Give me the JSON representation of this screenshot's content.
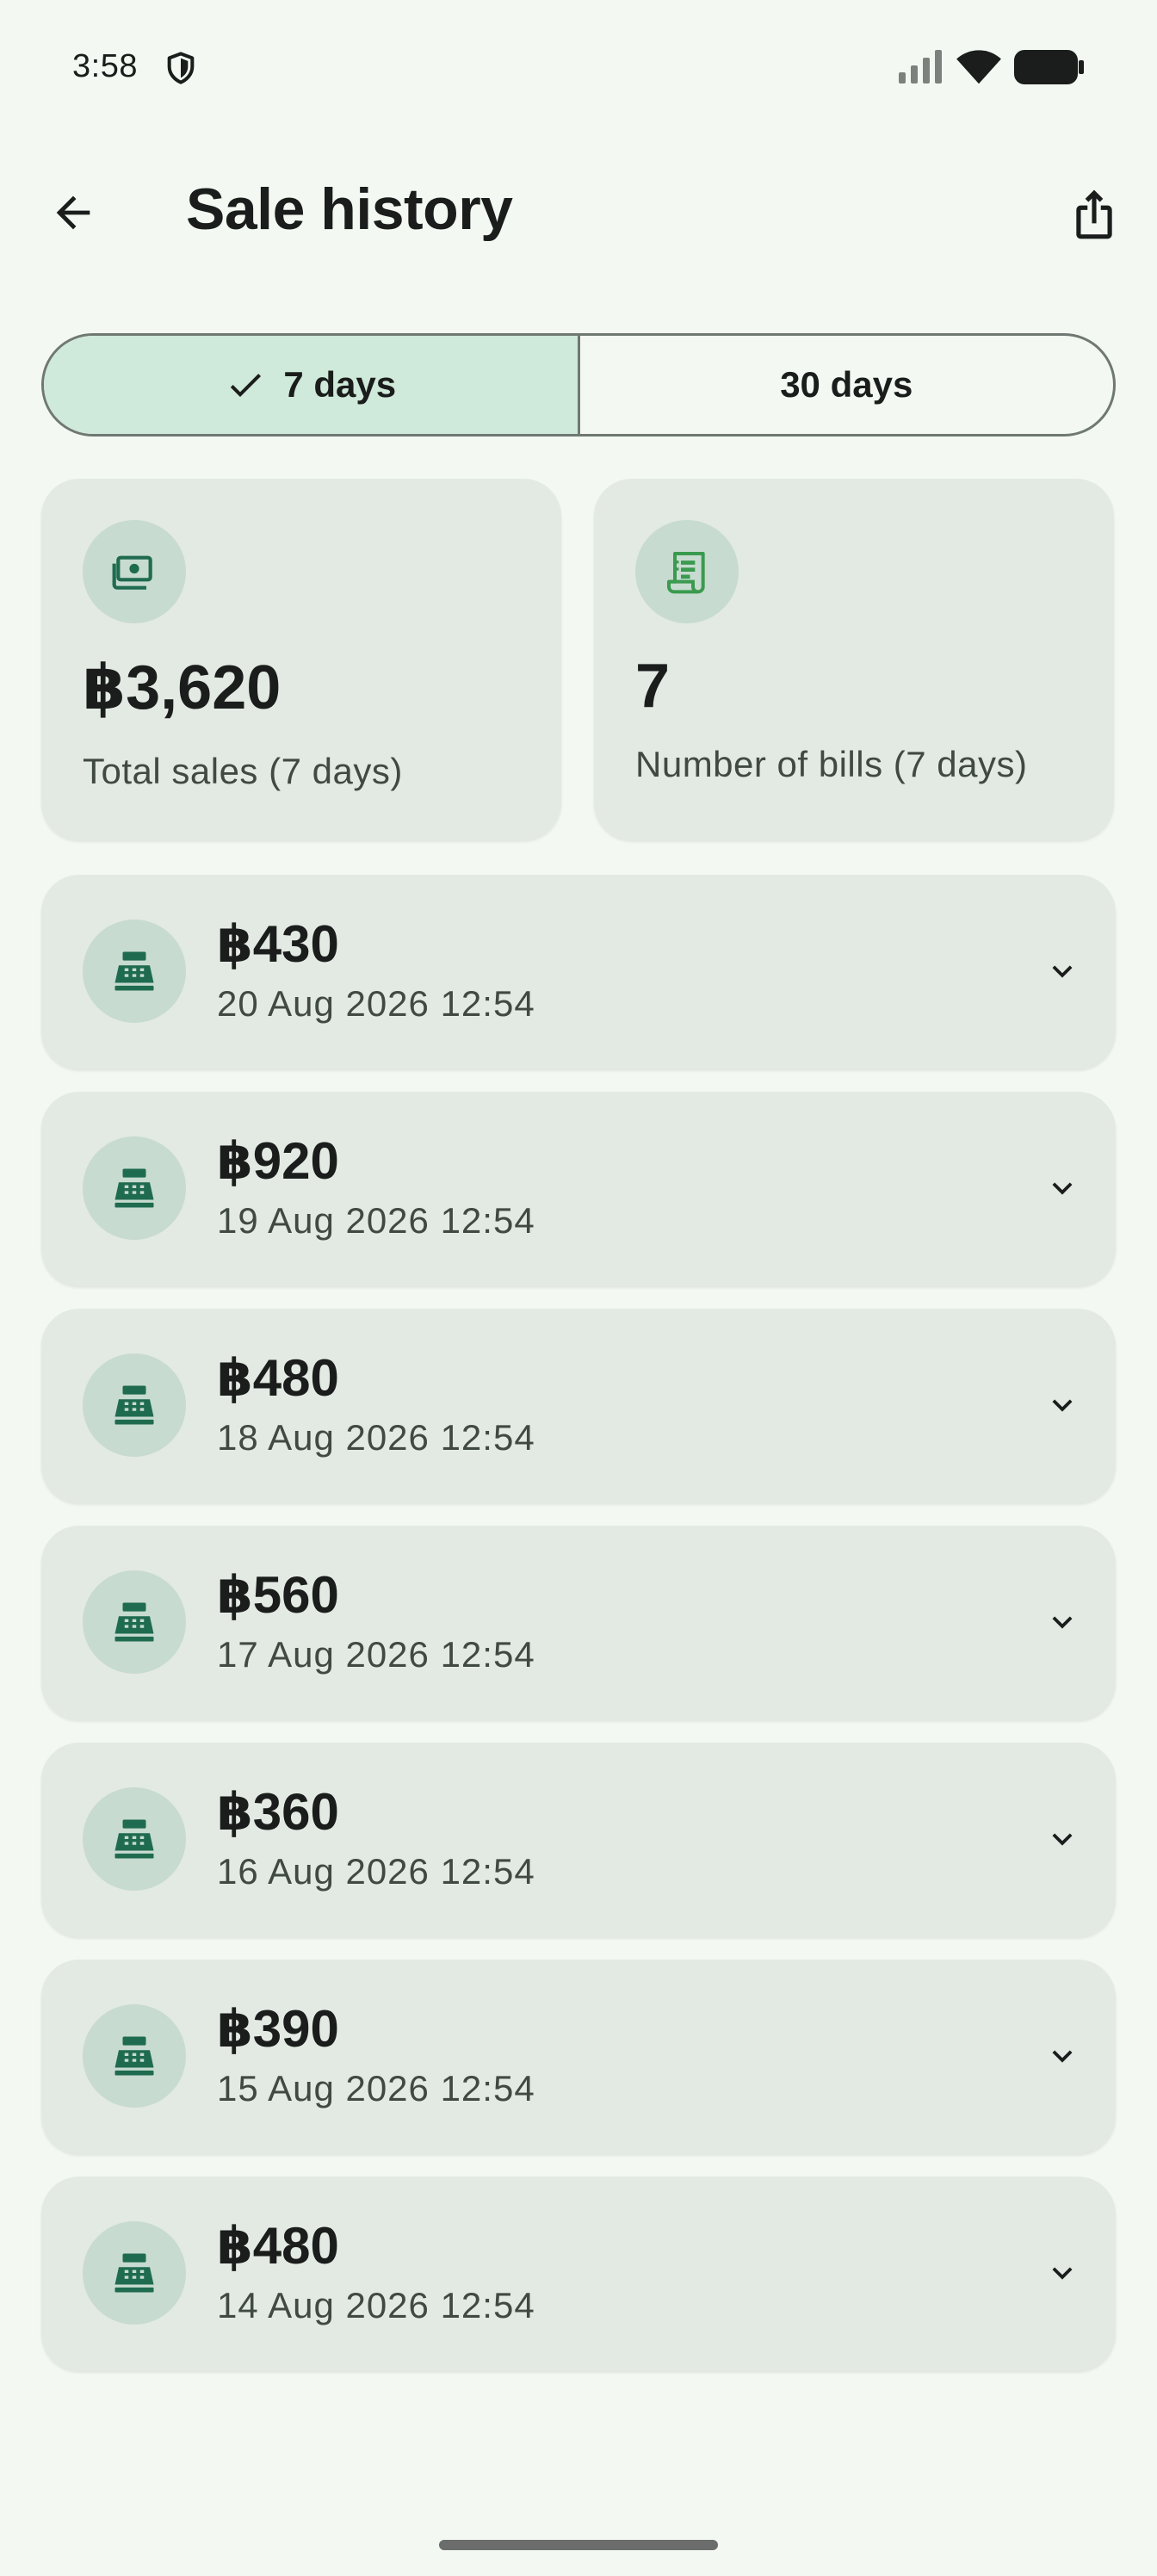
{
  "status_bar": {
    "time": "3:58",
    "icons": [
      "shield-icon",
      "signal-icon",
      "wifi-icon",
      "battery-icon"
    ]
  },
  "app_bar": {
    "title": "Sale history",
    "back_icon": "arrow-back-icon",
    "share_icon": "share-icon"
  },
  "range_selector": {
    "options": [
      {
        "label": "7 days",
        "selected": true
      },
      {
        "label": "30 days",
        "selected": false
      }
    ]
  },
  "summary": {
    "total_sales": {
      "value": "฿3,620",
      "label": "Total sales (7 days)",
      "icon": "money-icon"
    },
    "bill_count": {
      "value": "7",
      "label": "Number of bills (7 days)",
      "icon": "receipt-icon"
    }
  },
  "sales": [
    {
      "amount": "฿430",
      "date": "20 Aug 2026 12:54"
    },
    {
      "amount": "฿920",
      "date": "19 Aug 2026 12:54"
    },
    {
      "amount": "฿480",
      "date": "18 Aug 2026 12:54"
    },
    {
      "amount": "฿560",
      "date": "17 Aug 2026 12:54"
    },
    {
      "amount": "฿360",
      "date": "16 Aug 2026 12:54"
    },
    {
      "amount": "฿390",
      "date": "15 Aug 2026 12:54"
    },
    {
      "amount": "฿480",
      "date": "14 Aug 2026 12:54"
    }
  ],
  "colors": {
    "background": "#f3f9f2",
    "card": "#e3e9e3",
    "selected_segment": "#cfe9da",
    "icon_circle": "#c7dbd0",
    "accent_green": "#1f6b50"
  }
}
